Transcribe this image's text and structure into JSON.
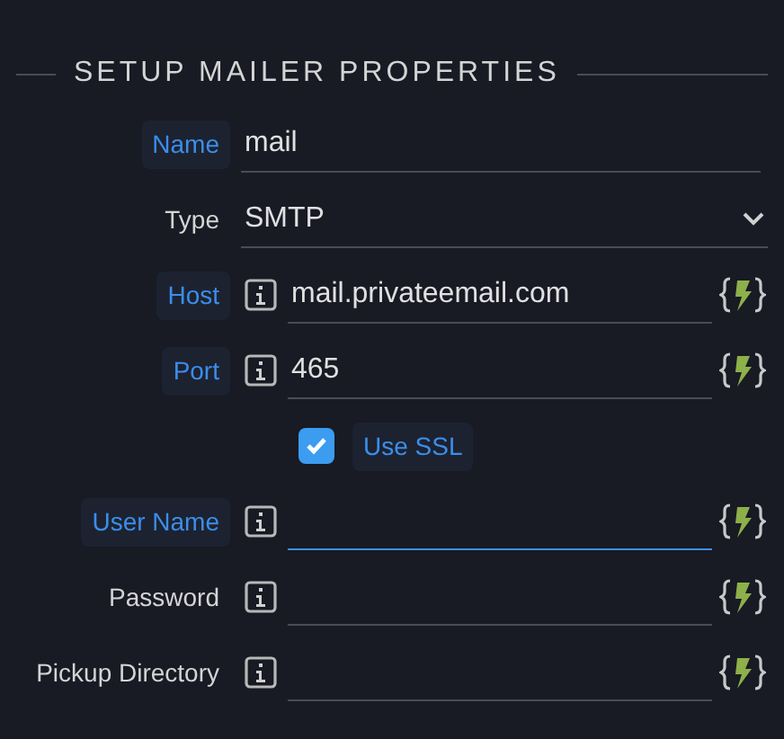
{
  "section_title": "SETUP MAILER PROPERTIES",
  "fields": [
    {
      "kind": "text",
      "label": "Name",
      "highlighted": true,
      "value": "mail",
      "info": false,
      "dynamic": false,
      "focused": false
    },
    {
      "kind": "select",
      "label": "Type",
      "highlighted": false,
      "value": "SMTP"
    },
    {
      "kind": "text",
      "label": "Host",
      "highlighted": true,
      "value": "mail.privateemail.com",
      "info": true,
      "dynamic": true,
      "focused": false
    },
    {
      "kind": "text",
      "label": "Port",
      "highlighted": true,
      "value": "465",
      "info": true,
      "dynamic": true,
      "focused": false
    },
    {
      "kind": "checkbox",
      "label": "Use SSL",
      "highlighted": true,
      "checked": true
    },
    {
      "kind": "text",
      "label": "User Name",
      "highlighted": true,
      "info": true,
      "dynamic": true,
      "focused": true
    },
    {
      "kind": "text",
      "label": "Password",
      "highlighted": false,
      "info": true,
      "dynamic": true,
      "focused": false
    },
    {
      "kind": "text",
      "label": "Pickup Directory",
      "highlighted": false,
      "info": true,
      "dynamic": true,
      "focused": false
    }
  ]
}
